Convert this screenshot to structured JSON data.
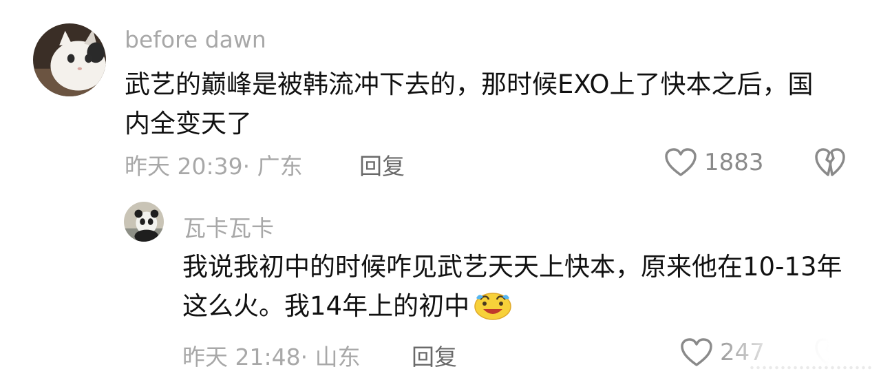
{
  "comments": [
    {
      "username": "before dawn",
      "text": "武艺的巅峰是被韩流冲下去的，那时候EXO上了快本之后，国内全变天了",
      "time": "昨天 20:39·",
      "location": "广东",
      "reply_label": "回复",
      "likes": "1883"
    },
    {
      "username": "瓦卡瓦卡",
      "text": "我说我初中的时候咋见武艺天天上快本，原来他在10-13年这么火。我14年上的初中",
      "time": "昨天 21:48·",
      "location": "山东",
      "reply_label": "回复",
      "likes": "247"
    }
  ],
  "colors": {
    "username": "#a8a8a8",
    "body_text": "#111111",
    "meta": "#a8a8a8",
    "reply": "#6a6a6a",
    "icon": "#8a8a8a"
  },
  "icons": {
    "like": "heart-outline-icon",
    "dislike": "broken-heart-icon",
    "emoji": "crying-laughing-emoji"
  }
}
